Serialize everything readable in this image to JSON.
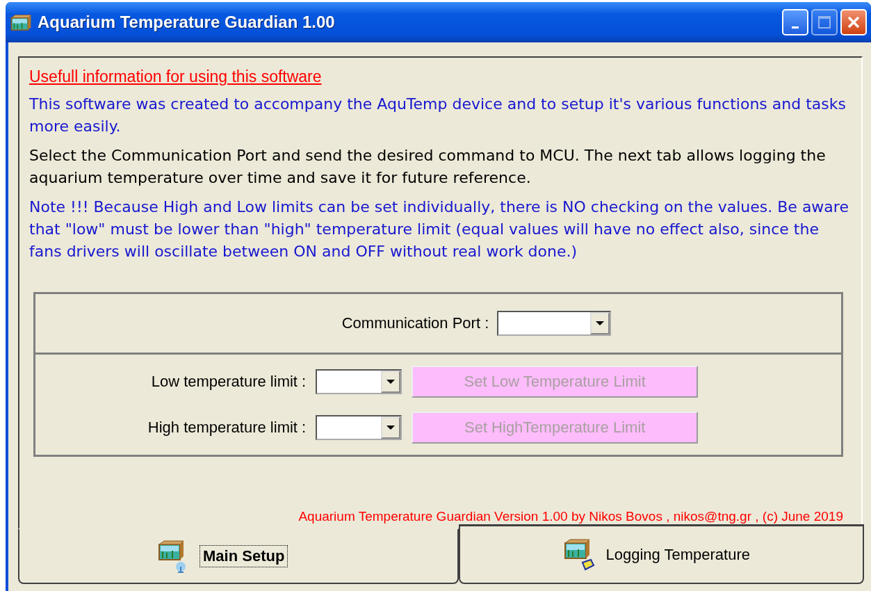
{
  "window": {
    "title": "Aquarium Temperature Guardian 1.00"
  },
  "info": {
    "heading": "Usefull information for using this software",
    "paragraphs": [
      {
        "kind": "info",
        "text": "This software was created to accompany the AquTemp device and to setup it's various functions and tasks more easily."
      },
      {
        "kind": "plain",
        "text": "Select the Communication Port and send the desired command to MCU. The next tab allows logging the aquarium temperature over time and save it for future reference."
      },
      {
        "kind": "info",
        "text": "Note !!! Because High and Low limits can be set individually, there is NO checking on the values. Be aware that \"low\" must be lower than \"high\" temperature limit (equal values will have no effect also, since the fans drivers will oscillate between ON and OFF without real work done.)"
      }
    ]
  },
  "port": {
    "label": "Communication Port :"
  },
  "limits": [
    {
      "label": "Low temperature limit :",
      "button": "Set Low Temperature Limit",
      "disabled": true
    },
    {
      "label": "High temperature limit :",
      "button": "Set HighTemperature Limit",
      "disabled": true
    }
  ],
  "credit": "Aquarium Temperature Guardian Version 1.00 by Nikos Bovos , nikos@tng.gr , (c) June 2019",
  "tabs": [
    {
      "label": "Main Setup",
      "selected": true,
      "kind": "setup"
    },
    {
      "label": "Logging Temperature",
      "selected": false,
      "kind": "logging"
    }
  ]
}
